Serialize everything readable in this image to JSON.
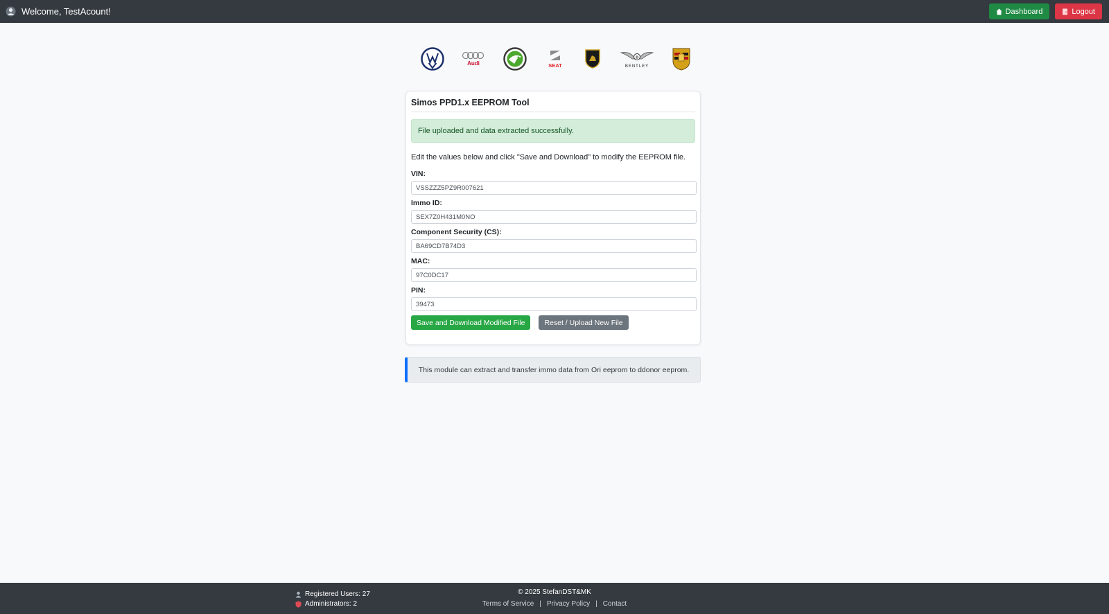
{
  "header": {
    "welcome": "Welcome, TestAcount!",
    "dashboard_label": "Dashboard",
    "logout_label": "Logout"
  },
  "brands": [
    "Volkswagen",
    "Audi",
    "Skoda",
    "SEAT",
    "Lamborghini",
    "Bentley",
    "Porsche"
  ],
  "brand_texts": {
    "audi": "Audi",
    "seat": "SEAT",
    "bentley": "BENTLEY"
  },
  "card": {
    "title": "Simos PPD1.x EEPROM Tool",
    "alert": "File uploaded and data extracted successfully.",
    "description": "Edit the values below and click \"Save and Download\" to modify the EEPROM file.",
    "fields": [
      {
        "label": "VIN:",
        "value": "VSSZZZ5PZ9R007621"
      },
      {
        "label": "Immo ID:",
        "value": "SEX7Z0H431M0NO"
      },
      {
        "label": "Component Security (CS):",
        "value": "BA69CD7B74D3"
      },
      {
        "label": "MAC:",
        "value": "97C0DC17"
      },
      {
        "label": "PIN:",
        "value": "39473"
      }
    ],
    "save_label": "Save and Download Modified File",
    "reset_label": "Reset / Upload New File"
  },
  "info": "This module can extract and transfer immo data from Ori eeprom to ddonor eeprom.",
  "footer": {
    "registered_users": "Registered Users: 27",
    "administrators": "Administrators: 2",
    "copyright": "© 2025 StefanDST&MK",
    "terms": "Terms of Service",
    "privacy": "Privacy Policy",
    "contact": "Contact",
    "separator": "|"
  },
  "colors": {
    "topbar": "#343a40",
    "success": "#28a745",
    "danger": "#dc3545",
    "info_border": "#0d6efd"
  }
}
